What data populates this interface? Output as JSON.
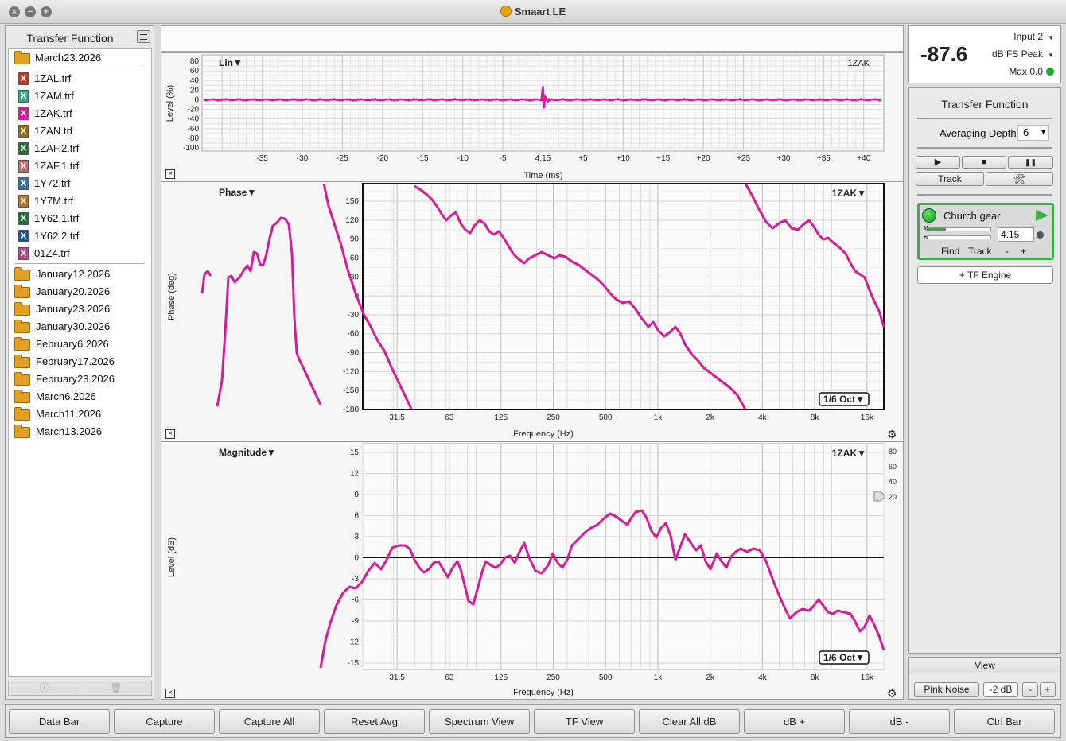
{
  "window": {
    "title": "Smaart LE"
  },
  "left_panel": {
    "title": "Transfer Function",
    "open_folder": "March23.2026",
    "files": [
      {
        "name": "1ZAL.trf",
        "color": "#c0392b"
      },
      {
        "name": "1ZAM.trf",
        "color": "#3aa98a"
      },
      {
        "name": "1ZAK.trf",
        "color": "#d61b98"
      },
      {
        "name": "1ZAN.trf",
        "color": "#9a6a12"
      },
      {
        "name": "1ZAF.2.trf",
        "color": "#2e6b3a"
      },
      {
        "name": "1ZAF.1.trf",
        "color": "#c46a6a"
      },
      {
        "name": "1Y72.trf",
        "color": "#3b6e9e"
      },
      {
        "name": "1Y7M.trf",
        "color": "#b5722a"
      },
      {
        "name": "1Y62.1.trf",
        "color": "#1f6e3c"
      },
      {
        "name": "1Y62.2.trf",
        "color": "#1f4f8c"
      },
      {
        "name": "01Z4.trf",
        "color": "#b04a8c"
      }
    ],
    "folders": [
      "January12.2026",
      "January20.2026",
      "January23.2026",
      "January30.2026",
      "February6.2026",
      "February17.2026",
      "February23.2026",
      "March6.2026",
      "March11.2026",
      "March13.2026"
    ],
    "file_icon_glyph": "X",
    "footer_icons": [
      "info-icon",
      "trash-icon"
    ]
  },
  "impulse": {
    "mode_label": "Lin▼",
    "trace_label": "1ZAK",
    "ylabel": "Level (%)",
    "xlabel": "Time (ms)",
    "y_ticks": [
      "80",
      "60",
      "40",
      "20",
      "0",
      "-20",
      "-40",
      "-60",
      "-80",
      "-100"
    ],
    "x_ticks": [
      "-35",
      "-30",
      "-25",
      "-20",
      "-15",
      "-10",
      "-5",
      "4.15",
      "+5",
      "+10",
      "+15",
      "+20",
      "+25",
      "+30",
      "+35",
      "+40"
    ],
    "close_glyph": "×"
  },
  "phase": {
    "mode_label": "Phase▼",
    "trace_label": "1ZAK▼",
    "smoothing": "1/6 Oct▼",
    "ylabel": "Phase (deg)",
    "xlabel": "Frequency (Hz)",
    "y_ticks": [
      "150",
      "120",
      "90",
      "60",
      "30",
      "0",
      "-30",
      "-60",
      "-90",
      "-120",
      "-150",
      "-180"
    ],
    "x_ticks": [
      "31.5",
      "63",
      "125",
      "250",
      "500",
      "1k",
      "2k",
      "4k",
      "8k",
      "16k"
    ],
    "close_glyph": "×",
    "gear_glyph": "⚙"
  },
  "magnitude": {
    "mode_label": "Magnitude▼",
    "trace_label": "1ZAK▼",
    "smoothing": "1/6 Oct▼",
    "ylabel": "Level (dB)",
    "xlabel": "Frequency (Hz)",
    "y_ticks": [
      "15",
      "12",
      "9",
      "6",
      "3",
      "0",
      "-3",
      "-6",
      "-9",
      "-12",
      "-15"
    ],
    "right_ticks": [
      "80",
      "60",
      "40",
      "20"
    ],
    "x_ticks": [
      "31.5",
      "63",
      "125",
      "250",
      "500",
      "1k",
      "2k",
      "4k",
      "8k",
      "16k"
    ],
    "close_glyph": "×",
    "gear_glyph": "⚙"
  },
  "trace_color": "#d61b98",
  "right_panel": {
    "input": "Input 2",
    "level": "-87.6",
    "level_unit": "dB FS Peak",
    "max": "Max 0.0",
    "title": "Transfer Function",
    "averaging_label": "Averaging Depth:",
    "averaging_value": "6",
    "transport": {
      "play": "▶",
      "stop": "■",
      "pause": "❚❚"
    },
    "track_label": "Track",
    "tools_glyph": "🛠",
    "engine": {
      "name": "Church gear",
      "meter_m": "M",
      "meter_r": "R",
      "delay": "4.15",
      "find": "Find",
      "track": "Track",
      "minus": "-",
      "plus": "+"
    },
    "add_engine": "+ TF Engine",
    "view": "View",
    "pink_noise": "Pink Noise",
    "noise_level": "-2 dB",
    "noise_minus": "-",
    "noise_plus": "+"
  },
  "toolbar": [
    "Data Bar",
    "Capture",
    "Capture All",
    "Reset Avg",
    "Spectrum View",
    "TF View",
    "Clear All dB",
    "dB +",
    "dB -",
    "Ctrl Bar"
  ]
}
